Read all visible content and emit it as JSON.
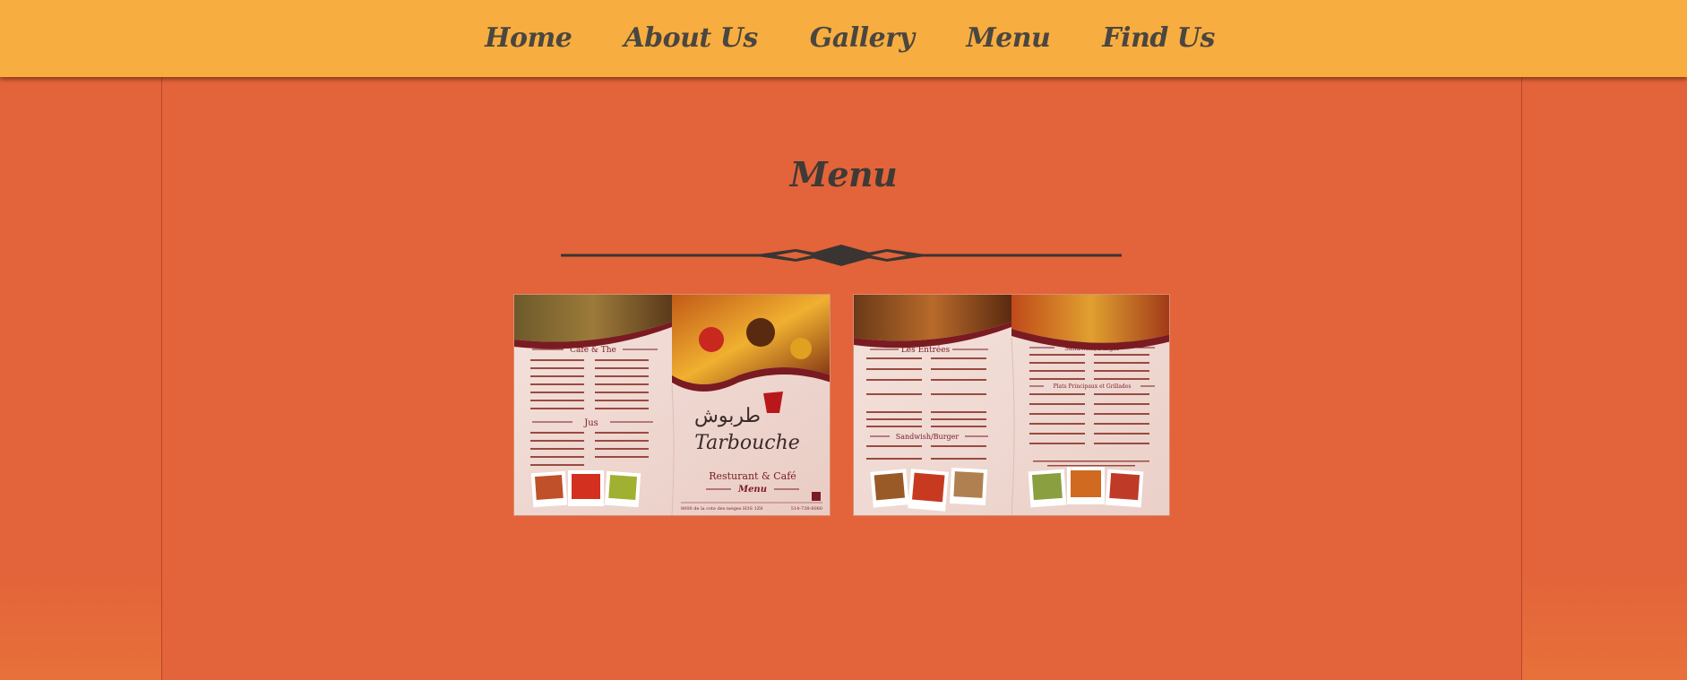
{
  "nav": {
    "items": [
      {
        "label": "Home"
      },
      {
        "label": "About Us"
      },
      {
        "label": "Gallery"
      },
      {
        "label": "Menu"
      },
      {
        "label": "Find Us"
      }
    ]
  },
  "page": {
    "title": "Menu"
  },
  "menu_images": {
    "left": {
      "section_1": "Café & The",
      "section_2": "Jus",
      "brand_arabic": "طربوش",
      "brand_latin": "Tarbouche",
      "tagline": "Resturant & Café",
      "subtitle": "Menu",
      "address": "8000 de la cote des neiges H3S 1Z8",
      "phone": "514-738-8060"
    },
    "right": {
      "section_1": "Les Entrées",
      "section_2": "Sandwish/Burger",
      "section_3": "Sandwish/Burger",
      "section_4": "Plats Principaux et Grillades"
    }
  },
  "colors": {
    "nav_bg": "#f7ad40",
    "page_bg": "#e3643a",
    "title_text": "#3f3a36",
    "nav_text": "#4a4640",
    "menu_accent": "#7a1b22"
  }
}
